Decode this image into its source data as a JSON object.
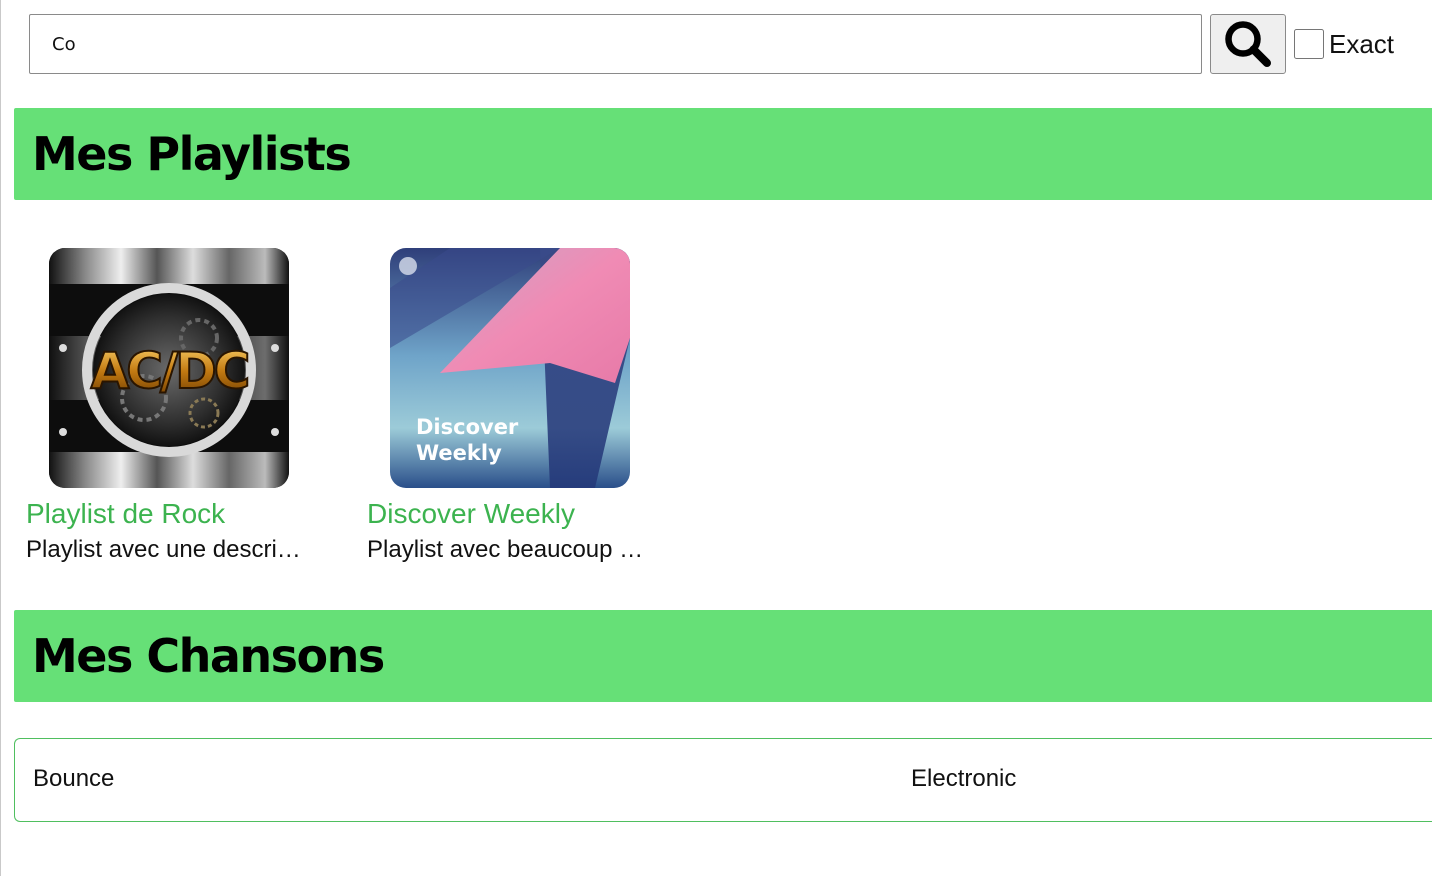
{
  "search": {
    "value": "Co",
    "exact_label": "Exact",
    "exact_checked": false
  },
  "playlists_section": {
    "title": "Mes Playlists",
    "items": [
      {
        "title": "Playlist de Rock",
        "description": "Playlist avec une description",
        "cover_logo": "AC/DC"
      },
      {
        "title": "Discover Weekly",
        "description": "Playlist avec beaucoup de chansons",
        "cover_text_line1": "Discover",
        "cover_text_line2": "Weekly"
      }
    ]
  },
  "songs_section": {
    "title": "Mes Chansons",
    "items": [
      {
        "title": "Bounce",
        "genre": "Electronic"
      }
    ]
  },
  "colors": {
    "header_green": "#66e077",
    "link_green": "#3cb34f",
    "row_border": "#4fbf5f"
  },
  "icons": {
    "search": "search-icon"
  }
}
